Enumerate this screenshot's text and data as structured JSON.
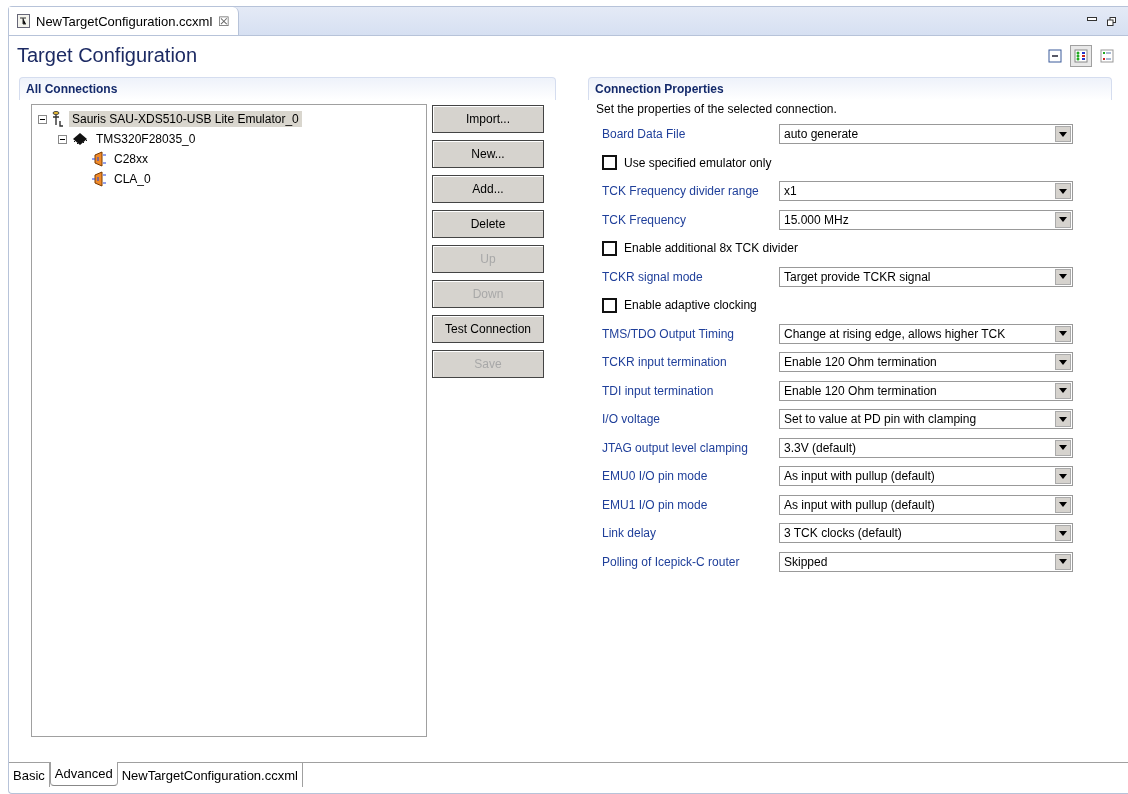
{
  "editor_tab": {
    "title": "NewTargetConfiguration.ccxml",
    "close": "☒"
  },
  "page_title": "Target Configuration",
  "toolbar": [
    {
      "kind": "collapse",
      "selected": false
    },
    {
      "kind": "grid",
      "selected": true
    },
    {
      "kind": "list",
      "selected": false
    }
  ],
  "connections": {
    "title": "All Connections",
    "tree": [
      {
        "label": "Sauris SAU-XDS510-USB Lite Emulator_0",
        "kind": "emulator",
        "selected": true,
        "expanded": true,
        "children": [
          {
            "label": "TMS320F28035_0",
            "kind": "chip",
            "selected": false,
            "expanded": true,
            "children": [
              {
                "label": "C28xx",
                "kind": "core",
                "selected": false
              },
              {
                "label": "CLA_0",
                "kind": "core",
                "selected": false
              }
            ]
          }
        ]
      }
    ],
    "buttons": [
      {
        "label": "Import...",
        "disabled": false
      },
      {
        "label": "New...",
        "disabled": false
      },
      {
        "label": "Add...",
        "disabled": false
      },
      {
        "label": "Delete",
        "disabled": false
      },
      {
        "label": "Up",
        "disabled": true
      },
      {
        "label": "Down",
        "disabled": true
      },
      {
        "label": "Test Connection",
        "disabled": false
      },
      {
        "label": "Save",
        "disabled": true
      }
    ]
  },
  "properties": {
    "title": "Connection Properties",
    "description": "Set the properties of the selected connection.",
    "rows": [
      {
        "kind": "select",
        "label": "Board Data File",
        "value": "auto generate"
      },
      {
        "kind": "checkbox",
        "label": "Use specified emulator only",
        "checked": false
      },
      {
        "kind": "select",
        "label": "TCK Frequency divider range",
        "value": "x1"
      },
      {
        "kind": "select",
        "label": "TCK Frequency",
        "value": "15.000 MHz"
      },
      {
        "kind": "checkbox",
        "label": "Enable additional 8x TCK divider",
        "checked": false
      },
      {
        "kind": "select",
        "label": "TCKR signal mode",
        "value": "Target provide TCKR signal"
      },
      {
        "kind": "checkbox",
        "label": "Enable adaptive clocking",
        "checked": false
      },
      {
        "kind": "select",
        "label": "TMS/TDO Output Timing",
        "value": "Change at rising edge, allows higher TCK"
      },
      {
        "kind": "select",
        "label": "TCKR input termination",
        "value": "Enable 120 Ohm termination"
      },
      {
        "kind": "select",
        "label": "TDI input termination",
        "value": "Enable 120 Ohm termination"
      },
      {
        "kind": "select",
        "label": "I/O voltage",
        "value": "Set to value at PD pin with clamping"
      },
      {
        "kind": "select",
        "label": "JTAG output level clamping",
        "value": "3.3V (default)"
      },
      {
        "kind": "select",
        "label": "EMU0 I/O pin mode",
        "value": "As input with pullup (default)"
      },
      {
        "kind": "select",
        "label": "EMU1 I/O pin mode",
        "value": "As input with pullup (default)"
      },
      {
        "kind": "select",
        "label": "Link delay",
        "value": "3 TCK clocks (default)"
      },
      {
        "kind": "select",
        "label": "Polling of Icepick-C router",
        "value": "Skipped"
      }
    ]
  },
  "bottom_tabs": [
    {
      "label": "Basic",
      "selected": false
    },
    {
      "label": "Advanced",
      "selected": true
    },
    {
      "label": "NewTargetConfiguration.ccxml",
      "selected": false
    }
  ]
}
